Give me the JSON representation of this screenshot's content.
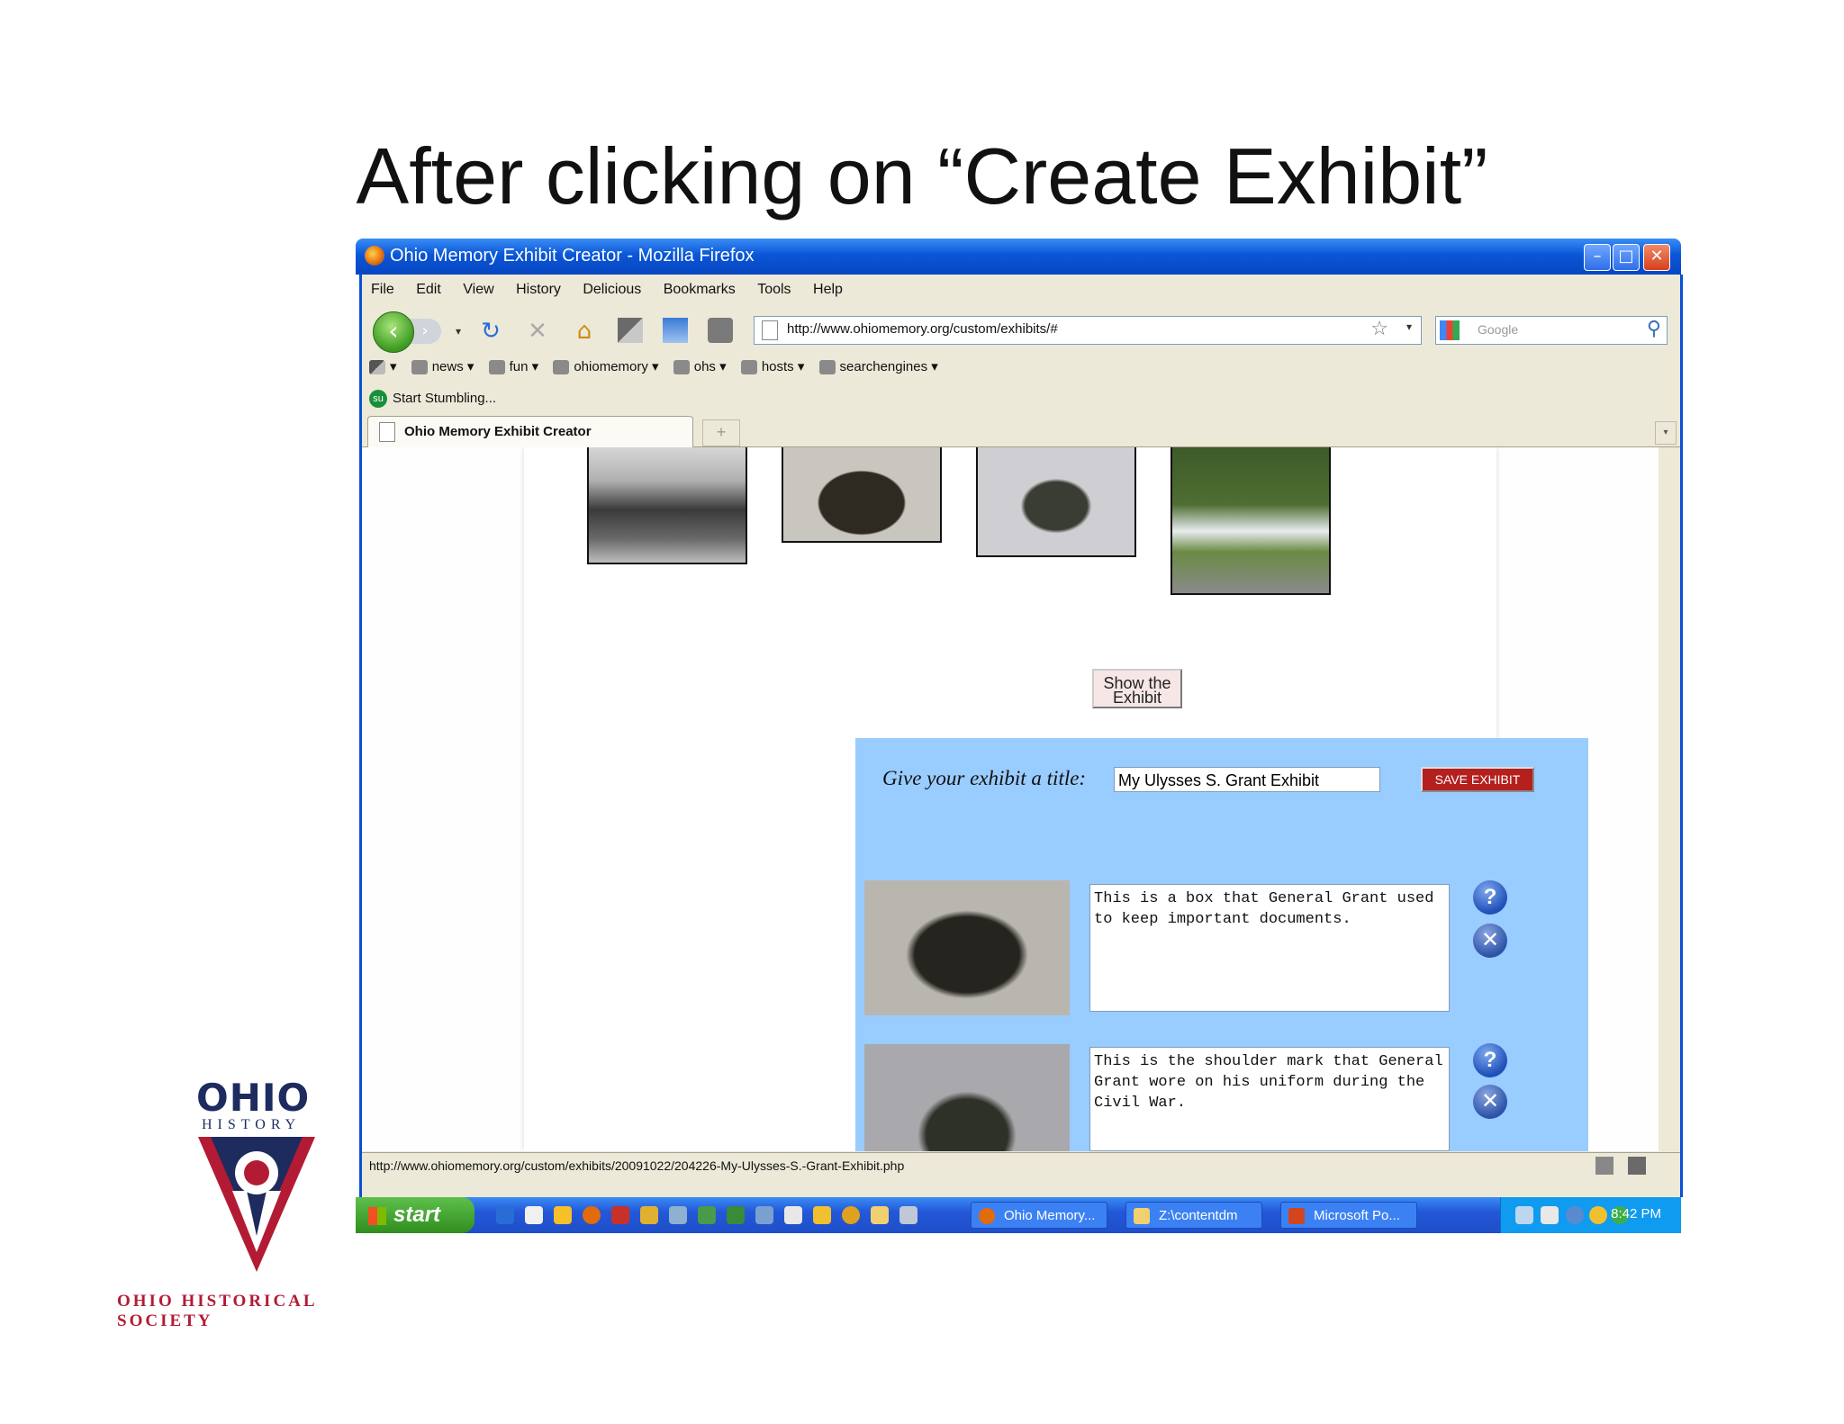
{
  "slide": {
    "title": "After clicking on “Create Exhibit”"
  },
  "window": {
    "title": "Ohio Memory Exhibit Creator - Mozilla Firefox",
    "menu": [
      "File",
      "Edit",
      "View",
      "History",
      "Delicious",
      "Bookmarks",
      "Tools",
      "Help"
    ],
    "url": "http://www.ohiomemory.org/custom/exhibits/#",
    "search_placeholder": "Google",
    "bookmarks": [
      "news",
      "fun",
      "ohiomemory",
      "ohs",
      "hosts",
      "searchengines"
    ],
    "stumble": "Start Stumbling...",
    "tab_label": "Ohio Memory Exhibit Creator",
    "status_text": "http://www.ohiomemory.org/custom/exhibits/20091022/204226-My-Ulysses-S.-Grant-Exhibit.php"
  },
  "page": {
    "show_button": "Show the Exhibit",
    "title_label": "Give your exhibit a title:",
    "title_value": "My Ulysses S. Grant Exhibit",
    "save_button": "SAVE EXHIBIT",
    "items": [
      {
        "text": "This is a box that General Grant used to keep important documents."
      },
      {
        "text": "This is the shoulder mark that General Grant wore on his uniform during the Civil War."
      }
    ]
  },
  "taskbar": {
    "start": "start",
    "tasks": [
      "Ohio Memory...",
      "Z:\\contentdm",
      "Microsoft Po..."
    ],
    "clock": "8:42 PM"
  },
  "logo": {
    "ohio": "OHIO",
    "history": "HISTORY",
    "society": "OHIO HISTORICAL SOCIETY"
  },
  "colors": {
    "panel": "#99ccff",
    "save": "#b3201d",
    "xp_blue": "#0a56d8"
  }
}
